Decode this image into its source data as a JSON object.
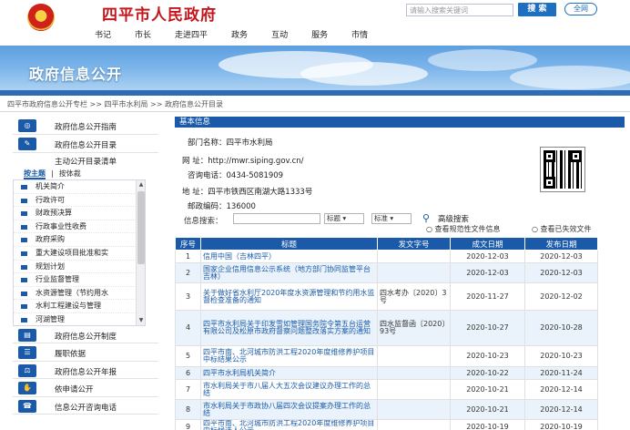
{
  "header": {
    "site_title": "四平市人民政府",
    "search_placeholder": "请输入搜索关键词",
    "search_button": "搜 索",
    "global_button": "全网"
  },
  "nav": [
    "书记",
    "市长",
    "走进四平",
    "政务",
    "互动",
    "服务",
    "市情"
  ],
  "banner": {
    "title": "政府信息公开"
  },
  "breadcrumb": "四平市政府信息公开专栏 >> 四平市水利局 >> 政府信息公开目录",
  "sidebar": {
    "top_menu": [
      {
        "label": "政府信息公开指南",
        "icon": "compass-icon"
      },
      {
        "label": "政府信息公开目录",
        "icon": "edit-icon"
      }
    ],
    "catalog_title": "主动公开目录清单",
    "tabs": [
      "按主题",
      "按体裁"
    ],
    "catalog_items": [
      "机关简介",
      "行政许可",
      "财政预决算",
      "行政事业性收费",
      "政府采购",
      "重大建设项目批准和实",
      "规划计划",
      "行业监督管理",
      "水资源管理（节约用水",
      "水利工程建设与管理",
      "河湖管理"
    ],
    "bottom_menu": [
      {
        "label": "政府信息公开制度",
        "icon": "folder-icon"
      },
      {
        "label": "履职依据",
        "icon": "document-icon"
      },
      {
        "label": "政府信息公开年报",
        "icon": "scale-icon"
      },
      {
        "label": "依申请公开",
        "icon": "hand-icon"
      },
      {
        "label": "信息公开咨询电话",
        "icon": "phone-icon"
      }
    ]
  },
  "basic_info": {
    "section_title": "基本信息",
    "dept_label": "部门名称：",
    "dept_value": "四平市水利局",
    "website_label": "网    址：",
    "website_value": "http://mwr.siping.gov.cn/",
    "phone_label": "咨询电话：",
    "phone_value": "0434-5081909",
    "address_label": "地    址：",
    "address_value": "四平市铁西区南湖大路1333号",
    "postcode_label": "邮政编码：",
    "postcode_value": "136000"
  },
  "info_search": {
    "label": "信息搜索：",
    "select1": "标题",
    "select2": "标准",
    "advanced": "高级搜索",
    "check1": "查看规范性文件信息",
    "check2": "查看已失效文件"
  },
  "table": {
    "headers": [
      "序号",
      "标题",
      "发文字号",
      "成文日期",
      "发布日期"
    ],
    "rows": [
      {
        "no": "1",
        "title": "信用中国（吉林四平）",
        "doc_no": "",
        "written": "2020-12-03",
        "published": "2020-12-03"
      },
      {
        "no": "2",
        "title": "国家企业信用信息公示系统（地方部门协同监管平台吉林）",
        "doc_no": "",
        "written": "2020-12-03",
        "published": "2020-12-03"
      },
      {
        "no": "3",
        "title": "关于做好省水利厅2020年度水资源管理和节约用水监督检查准备的通知",
        "doc_no": "四水考办〔2020〕3号",
        "written": "2020-11-27",
        "published": "2020-12-02"
      },
      {
        "no": "4",
        "title": "四平市水利局关于印发雪如管理国务院令第五台运营有限公司及松原市政府督察问题整改落实方案的通知",
        "doc_no": "四水监督函〔2020〕93号",
        "written": "2020-10-27",
        "published": "2020-10-28"
      },
      {
        "no": "5",
        "title": "四平市南、北河城市防洪工程2020年度维修养护项目中标结果公示",
        "doc_no": "",
        "written": "2020-10-23",
        "published": "2020-10-23"
      },
      {
        "no": "6",
        "title": "四平市水利局机关简介",
        "doc_no": "",
        "written": "2020-10-22",
        "published": "2020-11-24"
      },
      {
        "no": "7",
        "title": "市水利局关于市八届人大五次会议建议办理工作的总结",
        "doc_no": "",
        "written": "2020-10-21",
        "published": "2020-12-14"
      },
      {
        "no": "8",
        "title": "市水利局关于市政协八届四次会议提案办理工作的总结",
        "doc_no": "",
        "written": "2020-10-21",
        "published": "2020-12-14"
      },
      {
        "no": "9",
        "title": "四平市南、北河城市防洪工程2020年度维修养护项目中标候选人公示",
        "doc_no": "",
        "written": "2020-10-19",
        "published": "2020-10-19"
      }
    ]
  }
}
